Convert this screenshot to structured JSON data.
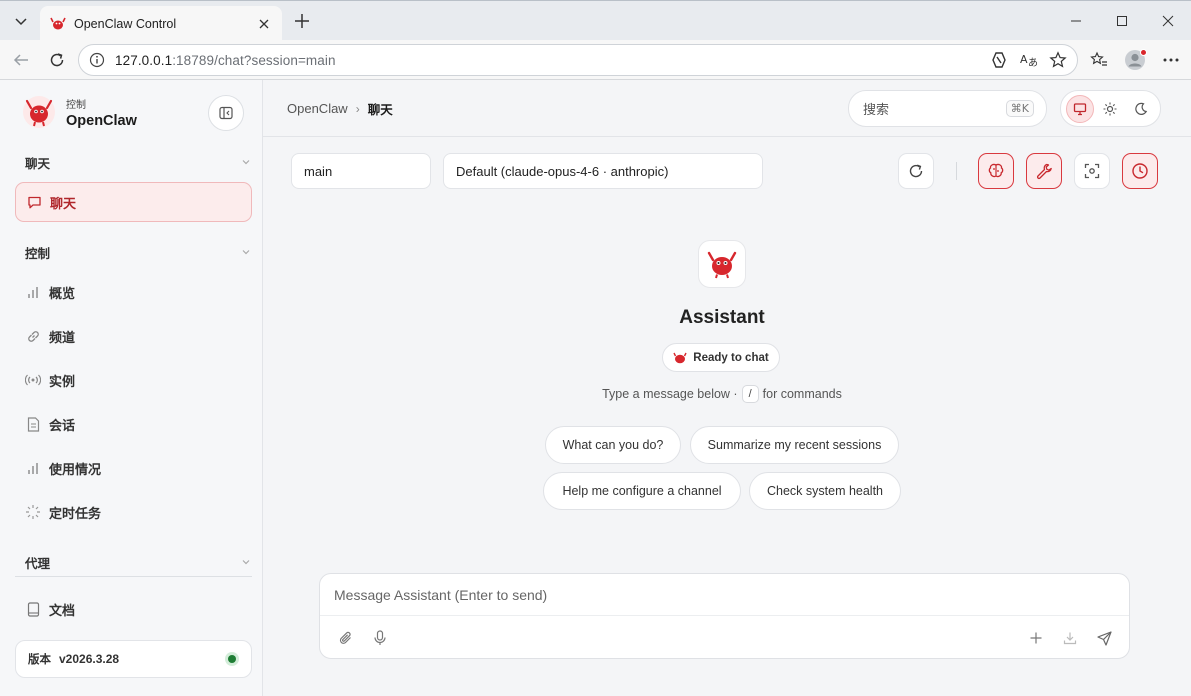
{
  "browser": {
    "tab_title": "OpenClaw Control",
    "url_host": "127.0.0.1",
    "url_rest": ":18789/chat?session=main"
  },
  "sidebar": {
    "brand_sub": "控制",
    "brand_name": "OpenClaw",
    "groups": {
      "chat": "聊天",
      "control": "控制",
      "agent": "代理"
    },
    "items": {
      "chat": "聊天",
      "overview": "概览",
      "channels": "频道",
      "instances": "实例",
      "sessions": "会话",
      "usage": "使用情况",
      "cron": "定时任务",
      "docs": "文档"
    },
    "version_label": "版本",
    "version_value": "v2026.3.28"
  },
  "topbar": {
    "crumb_root": "OpenClaw",
    "crumb_sep": "›",
    "crumb_current": "聊天",
    "search_placeholder": "搜索",
    "search_shortcut": "⌘K"
  },
  "chat": {
    "session_value": "main",
    "model_value": "Default (claude-opus-4-6 · anthropic)",
    "assistant_name": "Assistant",
    "status": "Ready to chat",
    "hint_before": "Type a message below ·",
    "hint_key": "/",
    "hint_after": "for commands",
    "suggestions": [
      "What can you do?",
      "Summarize my recent sessions",
      "Help me configure a channel",
      "Check system health"
    ],
    "composer_placeholder": "Message Assistant (Enter to send)"
  },
  "colors": {
    "accent": "#d9393f",
    "accent_bg": "#fcebec",
    "online": "#1e7d34"
  },
  "icons": [
    "lobster-logo-icon",
    "sidebar-collapse-icon",
    "chat-bubble-icon",
    "bar-chart-icon",
    "link-icon",
    "radio-signal-icon",
    "document-icon",
    "loader-icon",
    "book-icon",
    "monitor-icon",
    "sun-icon",
    "moon-icon",
    "refresh-icon",
    "brain-icon",
    "wrench-icon",
    "focus-icon",
    "clock-icon",
    "paperclip-icon",
    "mic-icon",
    "plus-icon",
    "download-icon",
    "send-icon"
  ]
}
